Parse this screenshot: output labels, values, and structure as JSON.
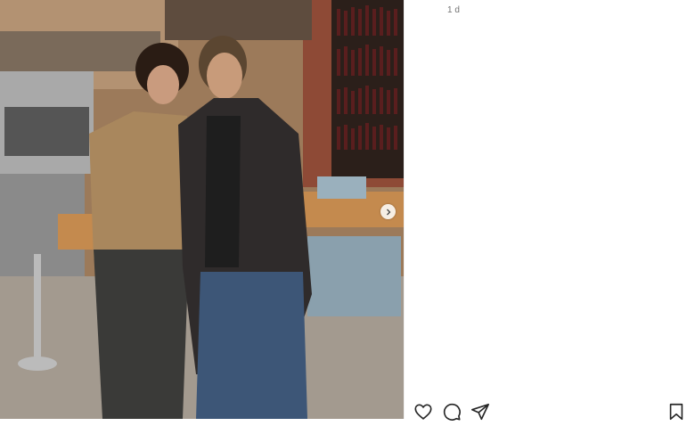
{
  "post": {
    "timestamp": "1 d"
  },
  "actions": {
    "like_icon": "heart-icon",
    "comment_icon": "comment-icon",
    "share_icon": "share-icon",
    "save_icon": "save-icon",
    "next_icon": "chevron-right-icon"
  },
  "colors": {
    "icon": "#262626",
    "timestamp": "#737373"
  }
}
